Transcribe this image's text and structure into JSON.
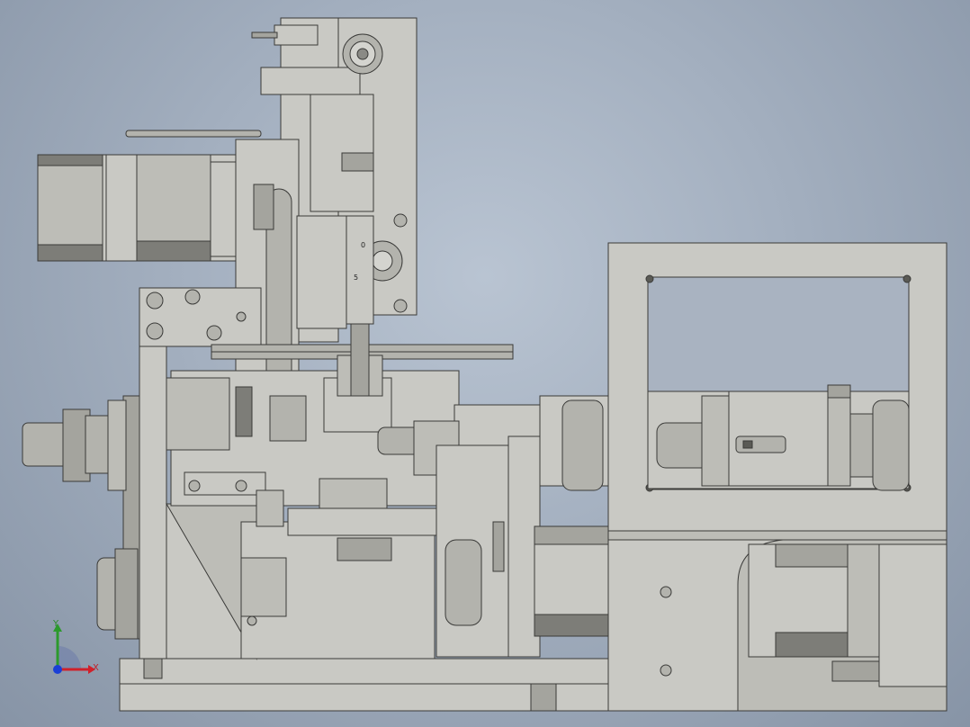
{
  "viewport": {
    "background_top": "#b9c4d2",
    "background_bottom": "#8794a6"
  },
  "model": {
    "body_color": "#c9c9c4",
    "shade_color": "#a4a49e",
    "dark_color": "#7d7d78",
    "outline_color": "#3a3a38",
    "part_labels": {
      "label_0": "0",
      "label_5": "5"
    }
  },
  "triad": {
    "x_label": "X",
    "y_label": "Y",
    "x_color": "#d0202a",
    "y_color": "#2c9a2c",
    "origin_color": "#1a3fd6"
  }
}
